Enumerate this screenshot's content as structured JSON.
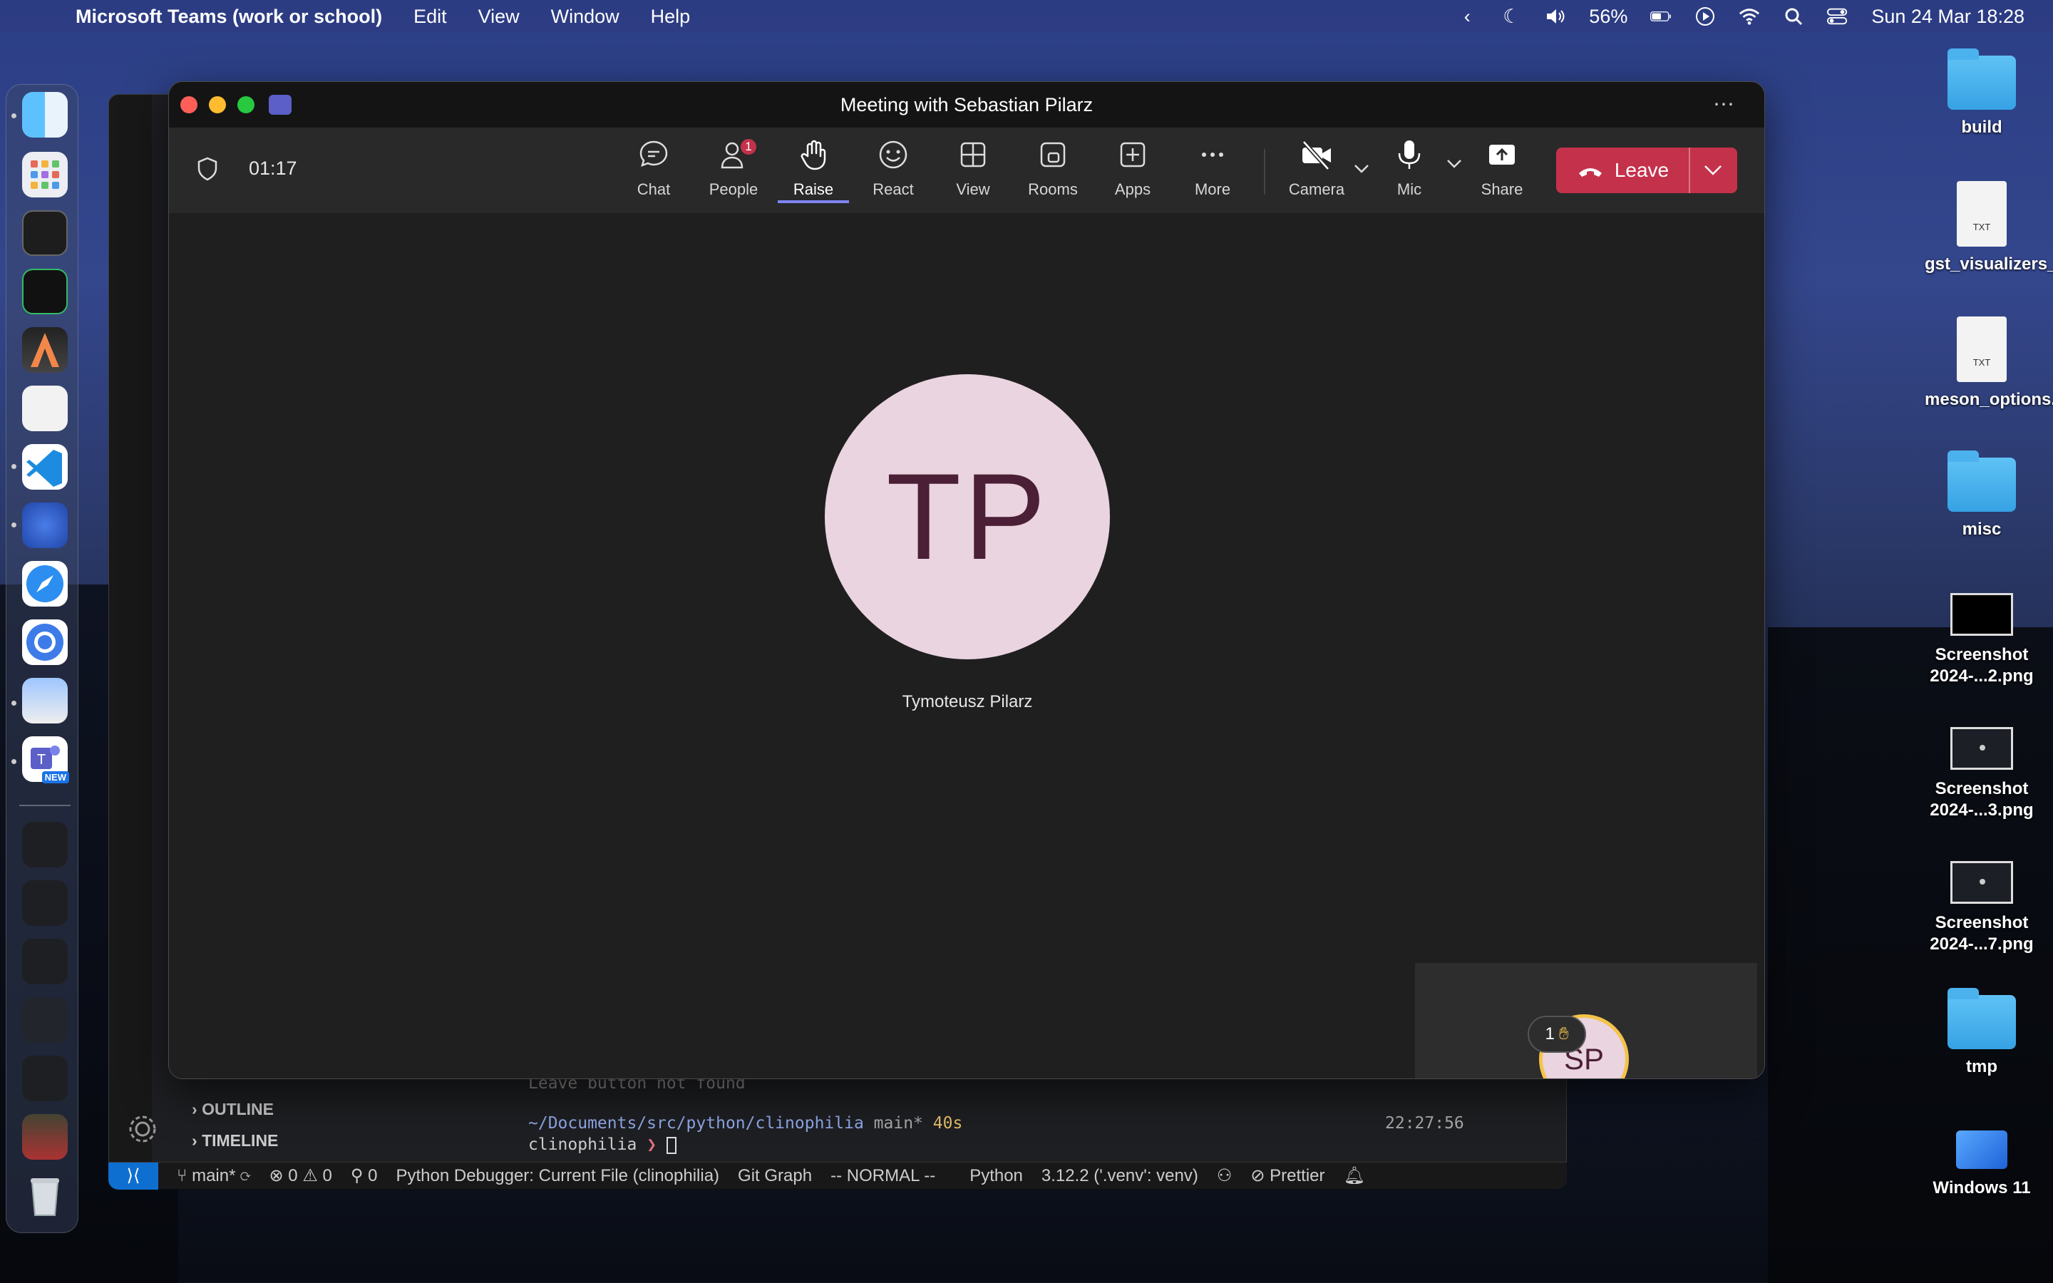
{
  "menubar": {
    "app_name": "Microsoft Teams (work or school)",
    "items": [
      "Edit",
      "View",
      "Window",
      "Help"
    ],
    "battery": "56%",
    "datetime": "Sun 24 Mar  18:28"
  },
  "dock": {
    "apps": [
      "finder-icon",
      "launchpad-icon",
      "terminal-icon",
      "iterm-icon",
      "alacritty-icon",
      "warp-icon",
      "vscode-icon",
      "firefox-icon",
      "safari-icon",
      "chrome-icon",
      "preview-icon",
      "teams-icon"
    ],
    "teams_badge": "NEW"
  },
  "desktop": {
    "items": [
      {
        "label": "build",
        "kind": "folder"
      },
      {
        "label": "gst_visualizers_loc.txt",
        "kind": "txt"
      },
      {
        "label": "meson_options.txt",
        "kind": "txt"
      },
      {
        "label": "misc",
        "kind": "folder"
      },
      {
        "label": "Screenshot 2024-...2.png",
        "kind": "image"
      },
      {
        "label": "Screenshot 2024-...3.png",
        "kind": "image"
      },
      {
        "label": "Screenshot 2024-...7.png",
        "kind": "image"
      },
      {
        "label": "tmp",
        "kind": "folder"
      },
      {
        "label": "Windows 11",
        "kind": "app"
      }
    ],
    "txt_tag": "TXT"
  },
  "vscode": {
    "outline": "OUTLINE",
    "timeline": "TIMELINE",
    "terminal_line1": "Leave button not found",
    "terminal_path": "~/Documents/src/python/clinophilia",
    "terminal_branch": "main*",
    "terminal_duration": "40s",
    "terminal_time": "22:27:56",
    "terminal_prompt": "clinophilia",
    "status": {
      "branch": "main*",
      "errors": "0",
      "warnings": "0",
      "ports": "0",
      "debugger": "Python Debugger: Current File (clinophilia)",
      "git_graph": "Git Graph",
      "mode": "-- NORMAL --",
      "language": "Python",
      "interpreter": "3.12.2 ('.venv': venv)",
      "prettier": "Prettier"
    }
  },
  "teams": {
    "title": "Meeting with Sebastian Pilarz",
    "timer": "01:17",
    "toolbar": {
      "chat": "Chat",
      "people": "People",
      "people_badge": "1",
      "raise": "Raise",
      "react": "React",
      "view": "View",
      "rooms": "Rooms",
      "apps": "Apps",
      "more": "More",
      "camera": "Camera",
      "mic": "Mic",
      "share": "Share",
      "leave": "Leave"
    },
    "participant": {
      "initials": "TP",
      "name": "Tymoteusz Pilarz"
    },
    "self": {
      "initials": "SP",
      "raised_hands": "1"
    }
  }
}
